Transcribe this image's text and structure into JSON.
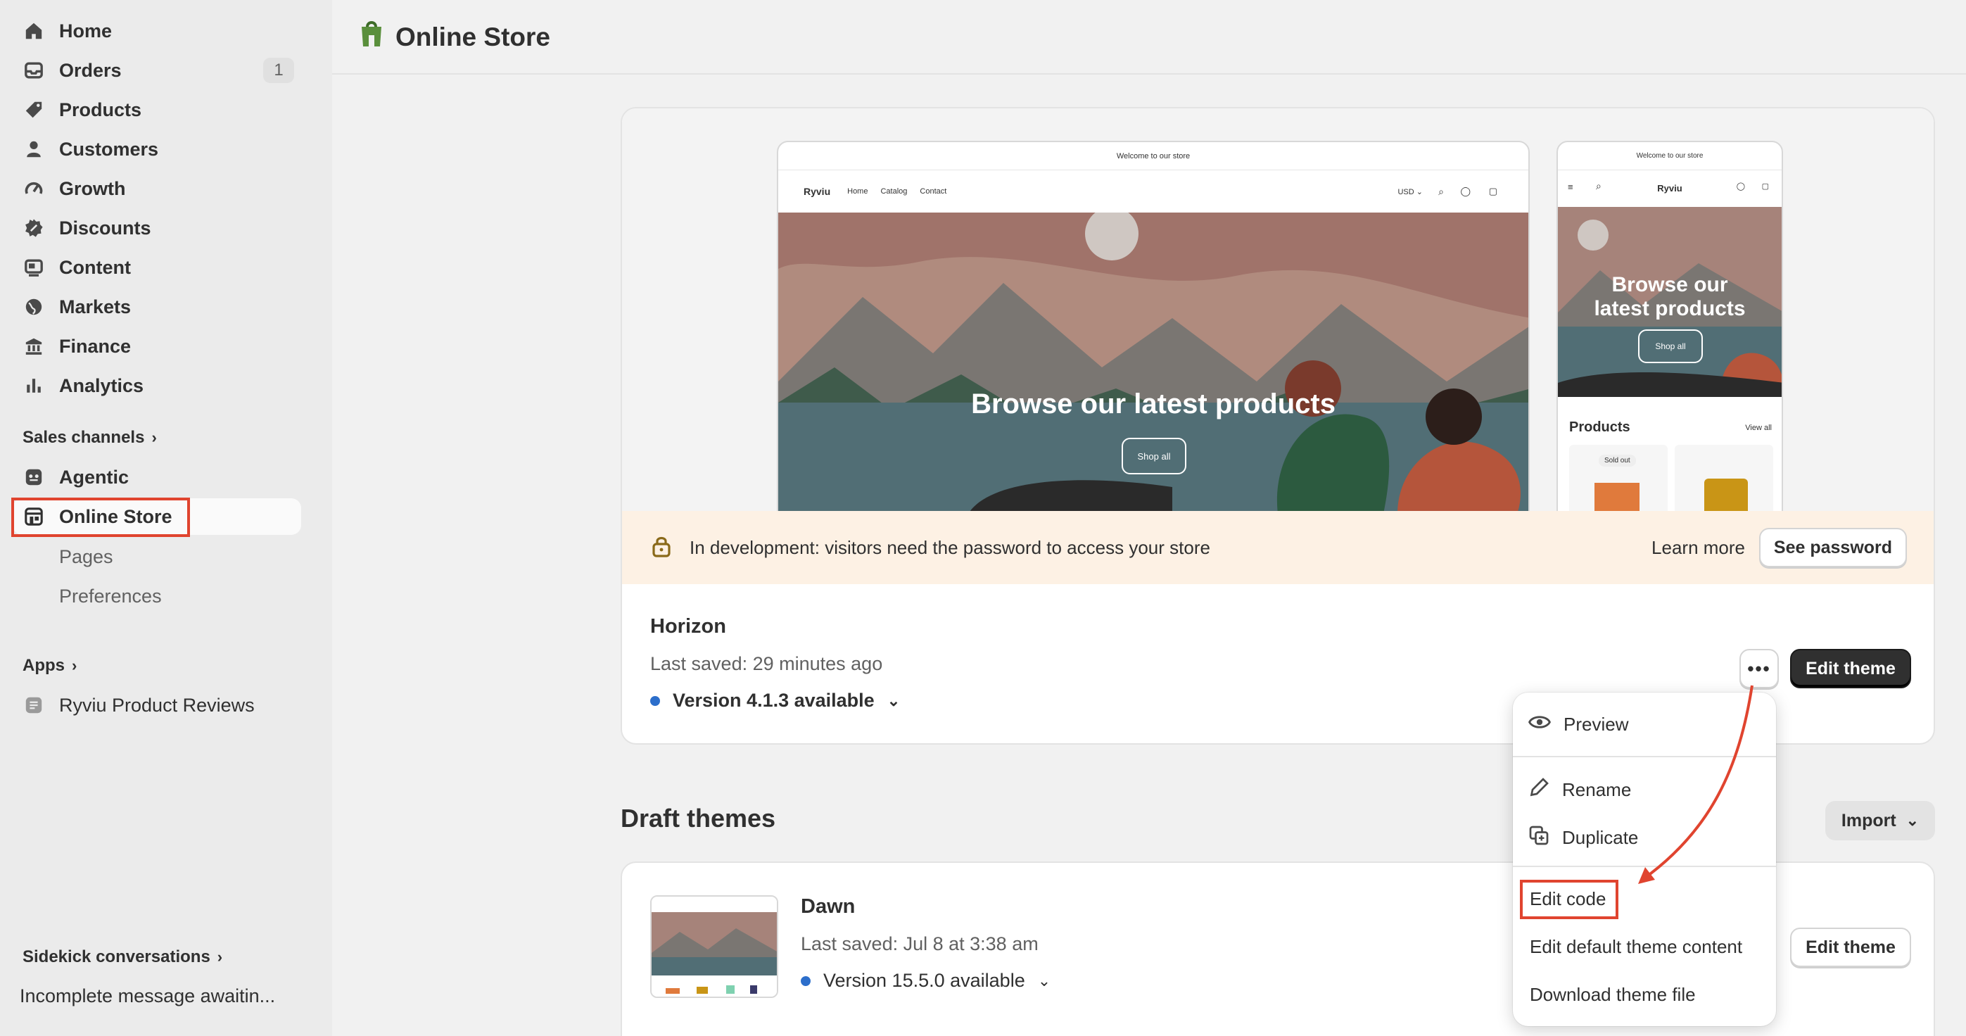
{
  "sidebar": {
    "items": [
      {
        "label": "Home",
        "icon": "home-icon"
      },
      {
        "label": "Orders",
        "icon": "orders-icon",
        "badge": "1"
      },
      {
        "label": "Products",
        "icon": "tag-icon"
      },
      {
        "label": "Customers",
        "icon": "person-icon"
      },
      {
        "label": "Growth",
        "icon": "gauge-icon"
      },
      {
        "label": "Discounts",
        "icon": "discount-icon"
      },
      {
        "label": "Content",
        "icon": "content-icon"
      },
      {
        "label": "Markets",
        "icon": "globe-icon"
      },
      {
        "label": "Finance",
        "icon": "bank-icon"
      },
      {
        "label": "Analytics",
        "icon": "bar-chart-icon"
      }
    ],
    "sales_channels_label": "Sales channels",
    "agentic_label": "Agentic",
    "online_store_label": "Online Store",
    "sub_items": [
      "Pages",
      "Preferences"
    ],
    "apps_label": "Apps",
    "app_item_label": "Ryviu Product Reviews",
    "sidekick_label": "Sidekick conversations",
    "sidekick_message": "Incomplete message awaitin..."
  },
  "main": {
    "title": "Online Store",
    "desktop_preview": {
      "announcement": "Welcome to our store",
      "brand": "Ryviu",
      "nav": [
        "Home",
        "Catalog",
        "Contact"
      ],
      "currency": "USD",
      "headline": "Browse our latest products",
      "button": "Shop all"
    },
    "mobile_preview": {
      "announcement": "Welcome to our store",
      "brand": "Ryviu",
      "headline_line1": "Browse our",
      "headline_line2": "latest products",
      "button": "Shop all",
      "products_heading": "Products",
      "view_all": "View all",
      "sold_out": "Sold out"
    },
    "dev_notice": "In development: visitors need the password to access your store",
    "learn_more": "Learn more",
    "see_password": "See password",
    "current_theme": {
      "name": "Horizon",
      "last_saved": "Last saved: 29 minutes ago",
      "version": "Version 4.1.3 available",
      "edit_button": "Edit theme"
    },
    "draft_heading": "Draft themes",
    "import_button": "Import",
    "draft_theme": {
      "name": "Dawn",
      "last_saved": "Last saved: Jul 8 at 3:38 am",
      "version": "Version 15.5.0 available",
      "edit_button": "Edit theme"
    },
    "menu": {
      "items": [
        "Preview",
        "Rename",
        "Duplicate",
        "Edit code",
        "Edit default theme content",
        "Download theme file"
      ]
    }
  },
  "colors": {
    "highlight": "#e0442f",
    "accent_blue": "#2c6ecb",
    "dev_banner": "#fdf1e4"
  }
}
